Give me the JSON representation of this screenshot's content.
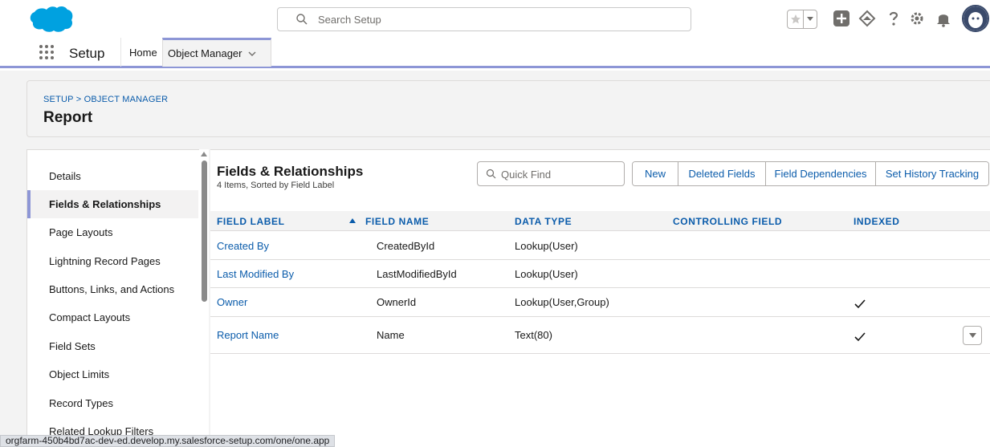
{
  "global_header": {
    "search_placeholder": "Search Setup",
    "icons": [
      "salesforce-cloud-logo",
      "search-icon",
      "star-icon",
      "chevron-down-icon",
      "plus-icon",
      "trailhead-icon",
      "help-icon",
      "gear-icon",
      "bell-icon",
      "avatar"
    ]
  },
  "app_nav": {
    "app_name": "Setup",
    "tabs": [
      {
        "label": "Home"
      },
      {
        "label": "Object Manager"
      }
    ]
  },
  "page_header": {
    "breadcrumb": "SETUP > OBJECT MANAGER",
    "title": "Report"
  },
  "sidebar": {
    "items": [
      {
        "label": "Details",
        "active": false
      },
      {
        "label": "Fields & Relationships",
        "active": true
      },
      {
        "label": "Page Layouts",
        "active": false
      },
      {
        "label": "Lightning Record Pages",
        "active": false
      },
      {
        "label": "Buttons, Links, and Actions",
        "active": false
      },
      {
        "label": "Compact Layouts",
        "active": false
      },
      {
        "label": "Field Sets",
        "active": false
      },
      {
        "label": "Object Limits",
        "active": false
      },
      {
        "label": "Record Types",
        "active": false
      },
      {
        "label": "Related Lookup Filters",
        "active": false
      }
    ]
  },
  "content": {
    "title": "Fields & Relationships",
    "subtitle": "4 Items, Sorted by Field Label",
    "quick_find_placeholder": "Quick Find",
    "buttons": [
      "New",
      "Deleted Fields",
      "Field Dependencies",
      "Set History Tracking"
    ],
    "columns": [
      "FIELD LABEL",
      "FIELD NAME",
      "DATA TYPE",
      "CONTROLLING FIELD",
      "INDEXED"
    ],
    "rows": [
      {
        "field_label": "Created By",
        "field_name": "CreatedById",
        "data_type": "Lookup(User)",
        "controlling_field": "",
        "indexed": false
      },
      {
        "field_label": "Last Modified By",
        "field_name": "LastModifiedById",
        "data_type": "Lookup(User)",
        "controlling_field": "",
        "indexed": false
      },
      {
        "field_label": "Owner",
        "field_name": "OwnerId",
        "data_type": "Lookup(User,Group)",
        "controlling_field": "",
        "indexed": true
      },
      {
        "field_label": "Report Name",
        "field_name": "Name",
        "data_type": "Text(80)",
        "controlling_field": "",
        "indexed": true
      }
    ]
  },
  "status_bar": {
    "url": "orgfarm-450b4bd7ac-dev-ed.develop.my.salesforce-setup.com/one/one.app"
  },
  "colors": {
    "brand_blue": "#0b5cab",
    "nav_accent": "#8d96d6",
    "logo_blue": "#00a1e0"
  }
}
